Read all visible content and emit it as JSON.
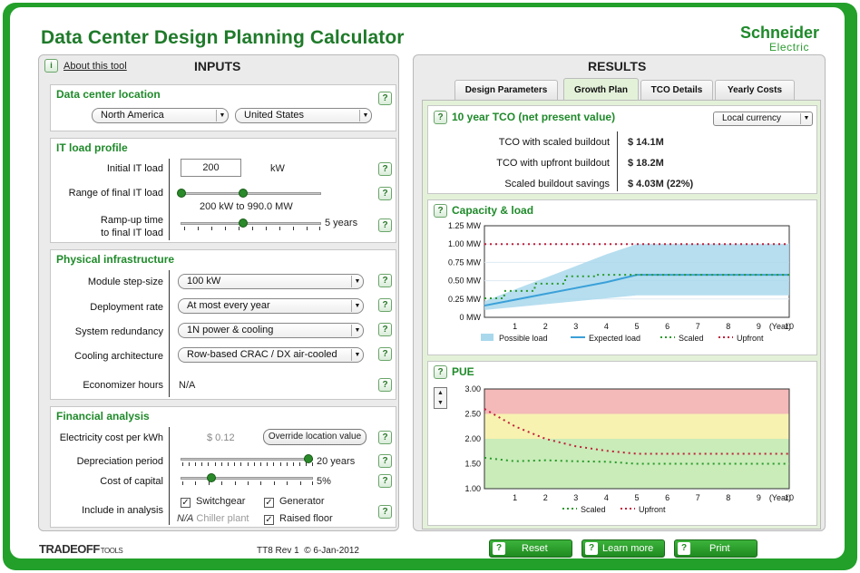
{
  "app_title": "Data Center Design Planning Calculator",
  "brand": {
    "name": "Schneider",
    "sub": "Electric"
  },
  "inputs": {
    "about_label": "About this tool",
    "header": "INPUTS",
    "location": {
      "title": "Data center location",
      "region": "North America",
      "country": "United States"
    },
    "it_load": {
      "title": "IT load profile",
      "initial_label": "Initial IT load",
      "initial_value": "200",
      "initial_unit": "kW",
      "range_label": "Range of final IT load",
      "range_text": "200 kW to 990.0 MW",
      "ramp_label1": "Ramp-up time",
      "ramp_label2": "to final IT load",
      "ramp_value": "5 years"
    },
    "physical": {
      "title": "Physical infrastructure",
      "module_label": "Module step-size",
      "module_value": "100 kW",
      "deploy_label": "Deployment rate",
      "deploy_value": "At most every year",
      "redund_label": "System redundancy",
      "redund_value": "1N power & cooling",
      "cooling_label": "Cooling architecture",
      "cooling_value": "Row-based CRAC / DX air-cooled",
      "econ_label": "Economizer hours",
      "econ_value": "N/A"
    },
    "financial": {
      "title": "Financial analysis",
      "elec_label": "Electricity cost per kWh",
      "elec_value": "$ 0.12",
      "override_label": "Override location value",
      "dep_label": "Depreciation period",
      "dep_value": "20 years",
      "capital_label": "Cost of capital",
      "capital_value": "5%",
      "include_label": "Include in analysis",
      "switchgear": "Switchgear",
      "generator": "Generator",
      "chiller_prefix": "N/A",
      "chiller": "Chiller plant",
      "raised_floor": "Raised floor"
    }
  },
  "results": {
    "header": "RESULTS",
    "tabs": [
      "Design Parameters",
      "Growth Plan",
      "TCO Details",
      "Yearly Costs"
    ],
    "active_tab": "Growth Plan",
    "tco": {
      "title": "10 year TCO (net present value)",
      "currency": "Local currency",
      "rows": [
        {
          "label": "TCO with scaled buildout",
          "value": "$ 14.1M"
        },
        {
          "label": "TCO with upfront buildout",
          "value": "$ 18.2M"
        },
        {
          "label": "Scaled buildout savings",
          "value": "$ 4.03M (22%)"
        }
      ]
    },
    "capacity_title": "Capacity & load",
    "pue_title": "PUE"
  },
  "chart_data": [
    {
      "type": "area",
      "title": "Capacity & load",
      "xlabel": "(Year)",
      "ylabel": "",
      "x": [
        0,
        1,
        2,
        3,
        4,
        5,
        6,
        7,
        8,
        9,
        10
      ],
      "x_ticks": [
        "1",
        "2",
        "3",
        "4",
        "5",
        "6",
        "7",
        "8",
        "9",
        "10"
      ],
      "y_ticks": [
        "0 MW",
        "0.25 MW",
        "0.50 MW",
        "0.75 MW",
        "1.00 MW",
        "1.25 MW"
      ],
      "ylim": [
        0,
        1.25
      ],
      "series": [
        {
          "name": "Possible load",
          "type": "area",
          "upper": [
            0.22,
            0.38,
            0.54,
            0.7,
            0.86,
            1.0,
            1.0,
            1.0,
            1.0,
            1.0,
            1.0
          ],
          "lower": [
            0.1,
            0.14,
            0.18,
            0.22,
            0.26,
            0.3,
            0.3,
            0.3,
            0.3,
            0.3,
            0.3
          ],
          "color": "#a9d8ec"
        },
        {
          "name": "Expected load",
          "type": "line",
          "values": [
            0.16,
            0.24,
            0.32,
            0.4,
            0.48,
            0.58,
            0.58,
            0.58,
            0.58,
            0.58,
            0.58
          ],
          "color": "#3aa0d8"
        },
        {
          "name": "Scaled",
          "type": "step",
          "values": [
            0.26,
            0.36,
            0.46,
            0.56,
            0.58,
            0.58,
            0.58,
            0.58,
            0.58,
            0.58,
            0.58
          ],
          "color": "#2a9a2a"
        },
        {
          "name": "Upfront",
          "type": "line",
          "values": [
            1.0,
            1.0,
            1.0,
            1.0,
            1.0,
            1.0,
            1.0,
            1.0,
            1.0,
            1.0,
            1.0
          ],
          "color": "#c0203a"
        }
      ],
      "legend": "bottom"
    },
    {
      "type": "line",
      "title": "PUE",
      "xlabel": "(Year)",
      "x": [
        0,
        1,
        2,
        3,
        4,
        5,
        6,
        7,
        8,
        9,
        10
      ],
      "x_ticks": [
        "1",
        "2",
        "3",
        "4",
        "5",
        "6",
        "7",
        "8",
        "9",
        "10"
      ],
      "y_ticks": [
        "1.00",
        "1.50",
        "2.00",
        "2.50",
        "3.00"
      ],
      "ylim": [
        1.0,
        3.0
      ],
      "bands": [
        {
          "from": 2.5,
          "to": 3.0,
          "color": "#f4b9b9"
        },
        {
          "from": 2.0,
          "to": 2.5,
          "color": "#f7f2b0"
        },
        {
          "from": 1.0,
          "to": 2.0,
          "color": "#c9ecb9"
        }
      ],
      "series": [
        {
          "name": "Scaled",
          "values": [
            1.62,
            1.55,
            1.57,
            1.55,
            1.54,
            1.5,
            1.5,
            1.5,
            1.5,
            1.5,
            1.5
          ],
          "color": "#2a9a2a"
        },
        {
          "name": "Upfront",
          "values": [
            2.6,
            2.25,
            2.0,
            1.85,
            1.76,
            1.7,
            1.7,
            1.7,
            1.7,
            1.7,
            1.7
          ],
          "color": "#c0203a"
        }
      ],
      "legend": "bottom"
    }
  ],
  "footer": {
    "brand": "TRADEOFF",
    "brand_sub": "TOOLS",
    "version": "TT8 Rev 1  © 6-Jan-2012",
    "buttons": [
      "Reset",
      "Learn more",
      "Print"
    ]
  }
}
